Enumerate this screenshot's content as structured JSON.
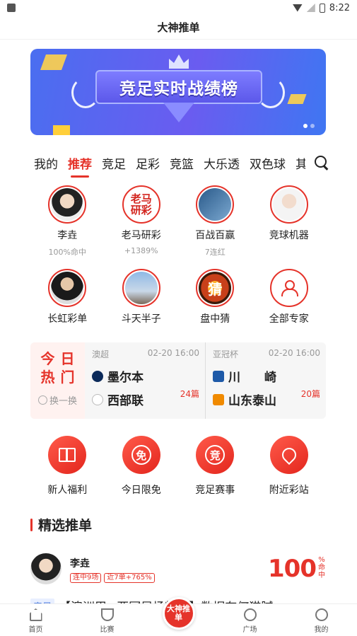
{
  "status_bar": {
    "time": "8:22"
  },
  "app": {
    "title": "大神推单"
  },
  "banner": {
    "title": "竞足实时战绩榜"
  },
  "tabs": [
    "我的",
    "推荐",
    "竞足",
    "足彩",
    "竞篮",
    "大乐透",
    "双色球",
    "其"
  ],
  "experts": [
    {
      "name": "李垚",
      "stat": "100%命中"
    },
    {
      "name": "老马研彩",
      "stat": "+1389%",
      "avatar_text": "老马\n研彩"
    },
    {
      "name": "百战百赢",
      "stat": "7连红"
    },
    {
      "name": "竞球机器",
      "stat": ""
    },
    {
      "name": "长虹彩单",
      "stat": ""
    },
    {
      "name": "斗天半子",
      "stat": ""
    },
    {
      "name": "盘中猜",
      "stat": "",
      "avatar_text": "猜"
    },
    {
      "name": "全部专家",
      "stat": ""
    }
  ],
  "hot": {
    "title_line1": "今日",
    "title_line2": "热门",
    "refresh": "换一换",
    "matches": [
      {
        "league": "澳超",
        "time": "02-20 16:00",
        "home": "墨尔本",
        "away": "西部联",
        "count": "24篇"
      },
      {
        "league": "亚冠杯",
        "time": "02-20 16:00",
        "home": "川　　崎",
        "away": "山东泰山",
        "count": "20篇"
      }
    ]
  },
  "shortcuts": [
    {
      "label": "新人福利",
      "icon": "gift-icon"
    },
    {
      "label": "今日限免",
      "icon": "free-icon",
      "glyph": "免"
    },
    {
      "label": "竞足赛事",
      "icon": "match-icon",
      "glyph": "竞"
    },
    {
      "label": "附近彩站",
      "icon": "location-pin-icon"
    }
  ],
  "section": {
    "title": "精选推单"
  },
  "post": {
    "author": "李垚",
    "tags": [
      "连中9场",
      "近7单+765%"
    ],
    "rate": "100",
    "rate_unit": "%命中",
    "category": "竞足",
    "title": "【澳洲甲+亚冠早场精选】数据有何猫腻."
  },
  "bottom_nav": [
    {
      "label": "首页",
      "icon": "home-icon"
    },
    {
      "label": "比赛",
      "icon": "trophy-icon"
    },
    {
      "label": "大神推单",
      "icon": "center-logo"
    },
    {
      "label": "广场",
      "icon": "square-icon"
    },
    {
      "label": "我的",
      "icon": "profile-icon"
    }
  ],
  "colors": {
    "accent": "#e5332a",
    "banner": "#5b6cf0"
  }
}
